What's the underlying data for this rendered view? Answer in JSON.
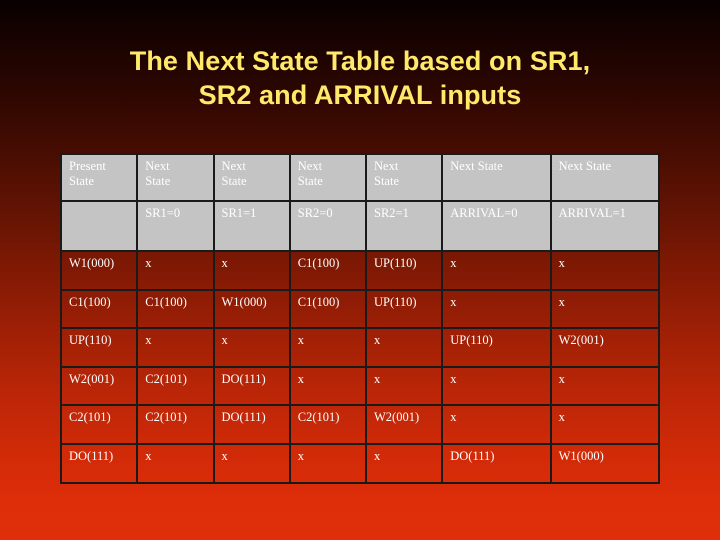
{
  "slide": {
    "title_lines": [
      "The Next State Table based on SR1,",
      "SR2 and ARRIVAL inputs"
    ],
    "title_color": "#ffe96b",
    "background_top_color": "#080000",
    "background_bottom_color": "#e02e0a"
  },
  "table": {
    "header_background": "#c4c4c4",
    "header_text_color": "#ffffff",
    "border_color": "#1a1a1a",
    "headers": [
      "Present State",
      "Next State",
      "Next State",
      "Next State",
      "Next State",
      "Next State",
      "Next State"
    ],
    "headers_split": [
      [
        "Present",
        "State"
      ],
      [
        "Next",
        "State"
      ],
      [
        "Next",
        "State"
      ],
      [
        "Next",
        "State"
      ],
      [
        "Next",
        "State"
      ],
      [
        "Next State",
        ""
      ],
      [
        "Next State",
        ""
      ]
    ],
    "subheaders": [
      "",
      "SR1=0",
      "SR1=1",
      "SR2=0",
      "SR2=1",
      "ARRIVAL=0",
      "ARRIVAL=1"
    ],
    "rows": [
      [
        "W1(000)",
        "x",
        "x",
        "C1(100)",
        "UP(110)",
        "x",
        "x"
      ],
      [
        "C1(100)",
        "C1(100)",
        "W1(000)",
        "C1(100)",
        "UP(110)",
        "x",
        "x"
      ],
      [
        "UP(110)",
        "x",
        "x",
        "x",
        "x",
        "UP(110)",
        "W2(001)"
      ],
      [
        "W2(001)",
        "C2(101)",
        "DO(111)",
        "x",
        "x",
        "x",
        "x"
      ],
      [
        "C2(101)",
        "C2(101)",
        "DO(111)",
        "C2(101)",
        "W2(001)",
        "x",
        "x"
      ],
      [
        "DO(111)",
        "x",
        "x",
        "x",
        "x",
        "DO(111)",
        "W1(000)"
      ]
    ]
  }
}
